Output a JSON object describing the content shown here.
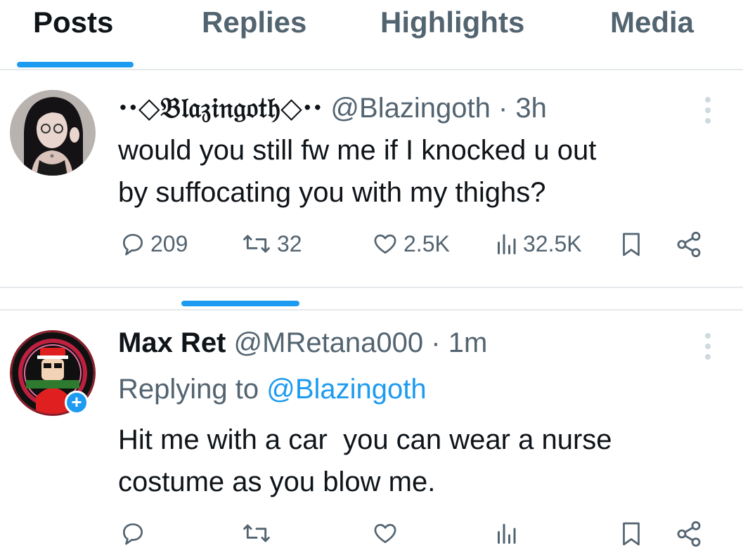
{
  "tabs": [
    {
      "label": "Posts",
      "active": true
    },
    {
      "label": "Replies",
      "active": false
    },
    {
      "label": "Highlights",
      "active": false
    },
    {
      "label": "Media",
      "active": false
    }
  ],
  "post1": {
    "display_name": "··◇𝔅𝔩𝔞𝔷𝔦𝔫𝔤𝔬𝔱𝔥◇··",
    "handle": "@Blazingoth",
    "separator": "·",
    "time": "3h",
    "text_lines": [
      "would you still fw me if I knocked u out",
      "by suffocating you with my thighs?"
    ],
    "stats": {
      "replies": "209",
      "reposts": "32",
      "likes": "2.5K",
      "views": "32.5K"
    }
  },
  "post2": {
    "display_name": "Max Ret",
    "handle": "@MRetana000",
    "separator": "·",
    "time": "1m",
    "replying_prefix": "Replying to",
    "replying_to": "@Blazingoth",
    "text_lines": [
      "Hit me with a car  you can wear a nurse",
      "costume as you blow me."
    ]
  },
  "colors": {
    "accent": "#1d9bf0",
    "muted": "#536471",
    "text": "#0f1419",
    "divider": "#e6e9ec"
  },
  "icons": [
    "reply-icon",
    "repost-icon",
    "like-icon",
    "views-icon",
    "bookmark-icon",
    "share-icon",
    "more-icon"
  ]
}
